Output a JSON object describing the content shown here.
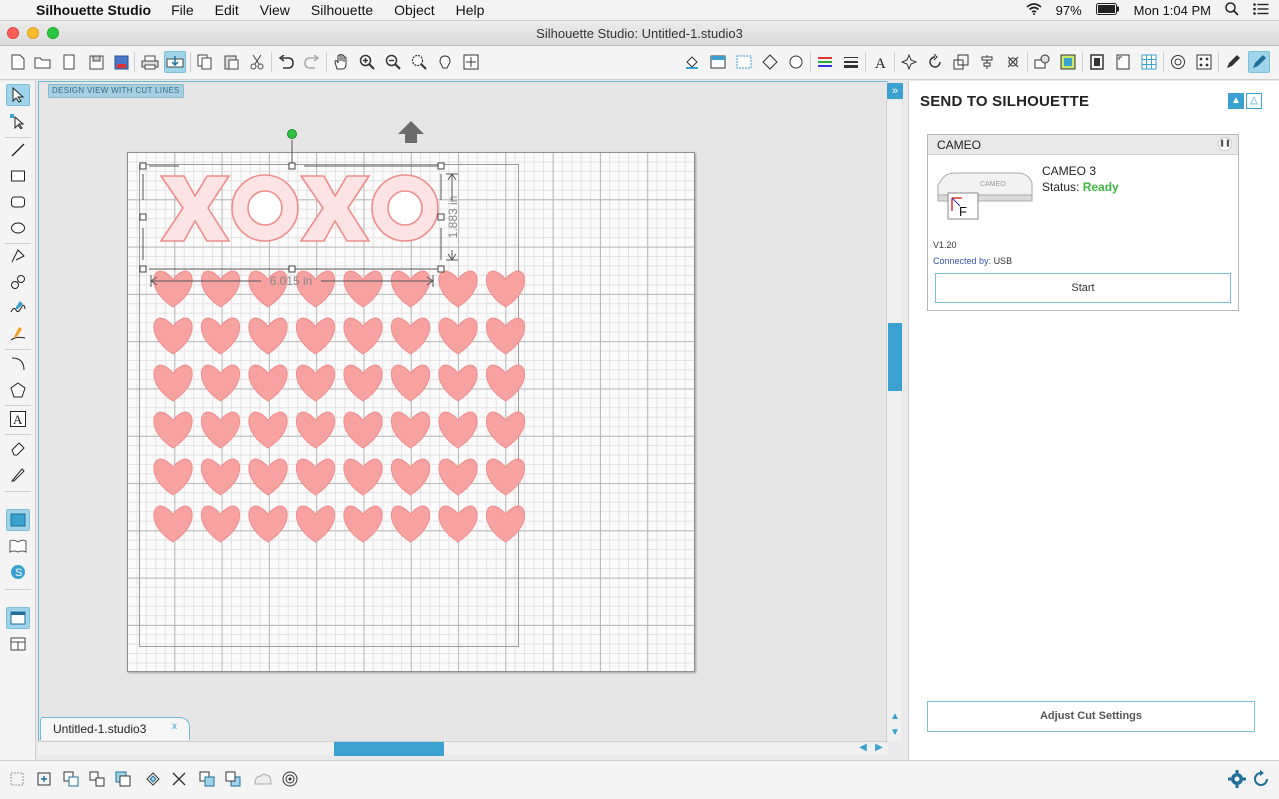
{
  "menubar": {
    "app_name": "Silhouette Studio",
    "menus": [
      "File",
      "Edit",
      "View",
      "Silhouette",
      "Object",
      "Help"
    ],
    "battery": "97%",
    "clock": "Mon 1:04 PM"
  },
  "window": {
    "title": "Silhouette Studio: Untitled-1.studio3"
  },
  "canvas": {
    "view_label": "DESIGN VIEW WITH CUT LINES",
    "text_art": "XOXO",
    "width_label": "6.015 in",
    "height_label": "1.883 in",
    "heart_rows": 6,
    "heart_cols": 8,
    "colors": {
      "heart_fill": "#f7a1a1",
      "heart_stroke": "#f08c8c",
      "outline": "#f08c8c",
      "accent": "#3aa1d1",
      "rotate_handle": "#2cc43f"
    }
  },
  "document": {
    "tab_name": "Untitled-1.studio3",
    "close_symbol": "x"
  },
  "panel": {
    "title": "SEND TO SILHOUETTE",
    "device_header": "CAMEO",
    "device_name": "CAMEO 3",
    "status_label": "Status:",
    "status_value": "Ready",
    "firmware": "V1.20",
    "connected_label": "Connected by:",
    "connected_value": "USB",
    "start_label": "Start",
    "adjust_label": "Adjust Cut Settings"
  }
}
